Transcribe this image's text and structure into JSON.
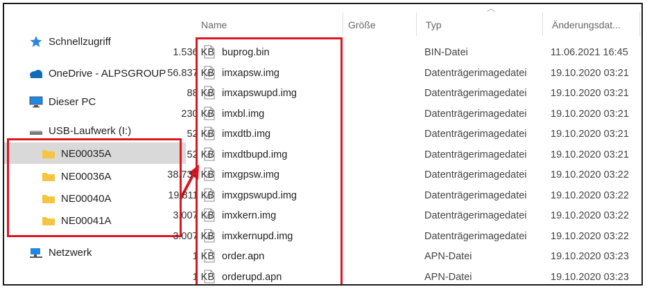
{
  "nav": {
    "quick_access": "Schnellzugriff",
    "onedrive": "OneDrive - ALPSGROUP",
    "this_pc": "Dieser PC",
    "usb": "USB-Laufwerk (I:)",
    "folders": [
      "NE00035A",
      "NE00036A",
      "NE00040A",
      "NE00041A"
    ],
    "network": "Netzwerk"
  },
  "columns": {
    "name": "Name",
    "size": "Größe",
    "type": "Typ",
    "date": "Änderungsdat..."
  },
  "files": [
    {
      "name": "buprog.bin",
      "size": "1.536 KB",
      "type": "BIN-Datei",
      "date": "11.06.2021 16:45",
      "icon": "file-icon"
    },
    {
      "name": "imxapsw.img",
      "size": "56.837 KB",
      "type": "Datenträgerimagedatei",
      "date": "19.10.2020 03:21",
      "icon": "disk-image-icon"
    },
    {
      "name": "imxapswupd.img",
      "size": "88 KB",
      "type": "Datenträgerimagedatei",
      "date": "19.10.2020 03:21",
      "icon": "disk-image-icon"
    },
    {
      "name": "imxbl.img",
      "size": "230 KB",
      "type": "Datenträgerimagedatei",
      "date": "19.10.2020 03:21",
      "icon": "disk-image-icon"
    },
    {
      "name": "imxdtb.img",
      "size": "52 KB",
      "type": "Datenträgerimagedatei",
      "date": "19.10.2020 03:21",
      "icon": "disk-image-icon"
    },
    {
      "name": "imxdtbupd.img",
      "size": "52 KB",
      "type": "Datenträgerimagedatei",
      "date": "19.10.2020 03:21",
      "icon": "disk-image-icon"
    },
    {
      "name": "imxgpsw.img",
      "size": "38.737 KB",
      "type": "Datenträgerimagedatei",
      "date": "19.10.2020 03:22",
      "icon": "disk-image-icon"
    },
    {
      "name": "imxgpswupd.img",
      "size": "19.811 KB",
      "type": "Datenträgerimagedatei",
      "date": "19.10.2020 03:22",
      "icon": "disk-image-icon"
    },
    {
      "name": "imxkern.img",
      "size": "3.007 KB",
      "type": "Datenträgerimagedatei",
      "date": "19.10.2020 03:22",
      "icon": "disk-image-icon"
    },
    {
      "name": "imxkernupd.img",
      "size": "3.007 KB",
      "type": "Datenträgerimagedatei",
      "date": "19.10.2020 03:22",
      "icon": "disk-image-icon"
    },
    {
      "name": "order.apn",
      "size": "1 KB",
      "type": "APN-Datei",
      "date": "19.10.2020 03:23",
      "icon": "file-icon"
    },
    {
      "name": "orderupd.apn",
      "size": "1 KB",
      "type": "APN-Datei",
      "date": "19.10.2020 03:23",
      "icon": "file-icon"
    }
  ],
  "colors": {
    "highlight": "#e0141e",
    "selection": "#d9d9d9",
    "folder": "#f5c542",
    "star": "#2e86de",
    "cloud": "#0f6cbd"
  }
}
